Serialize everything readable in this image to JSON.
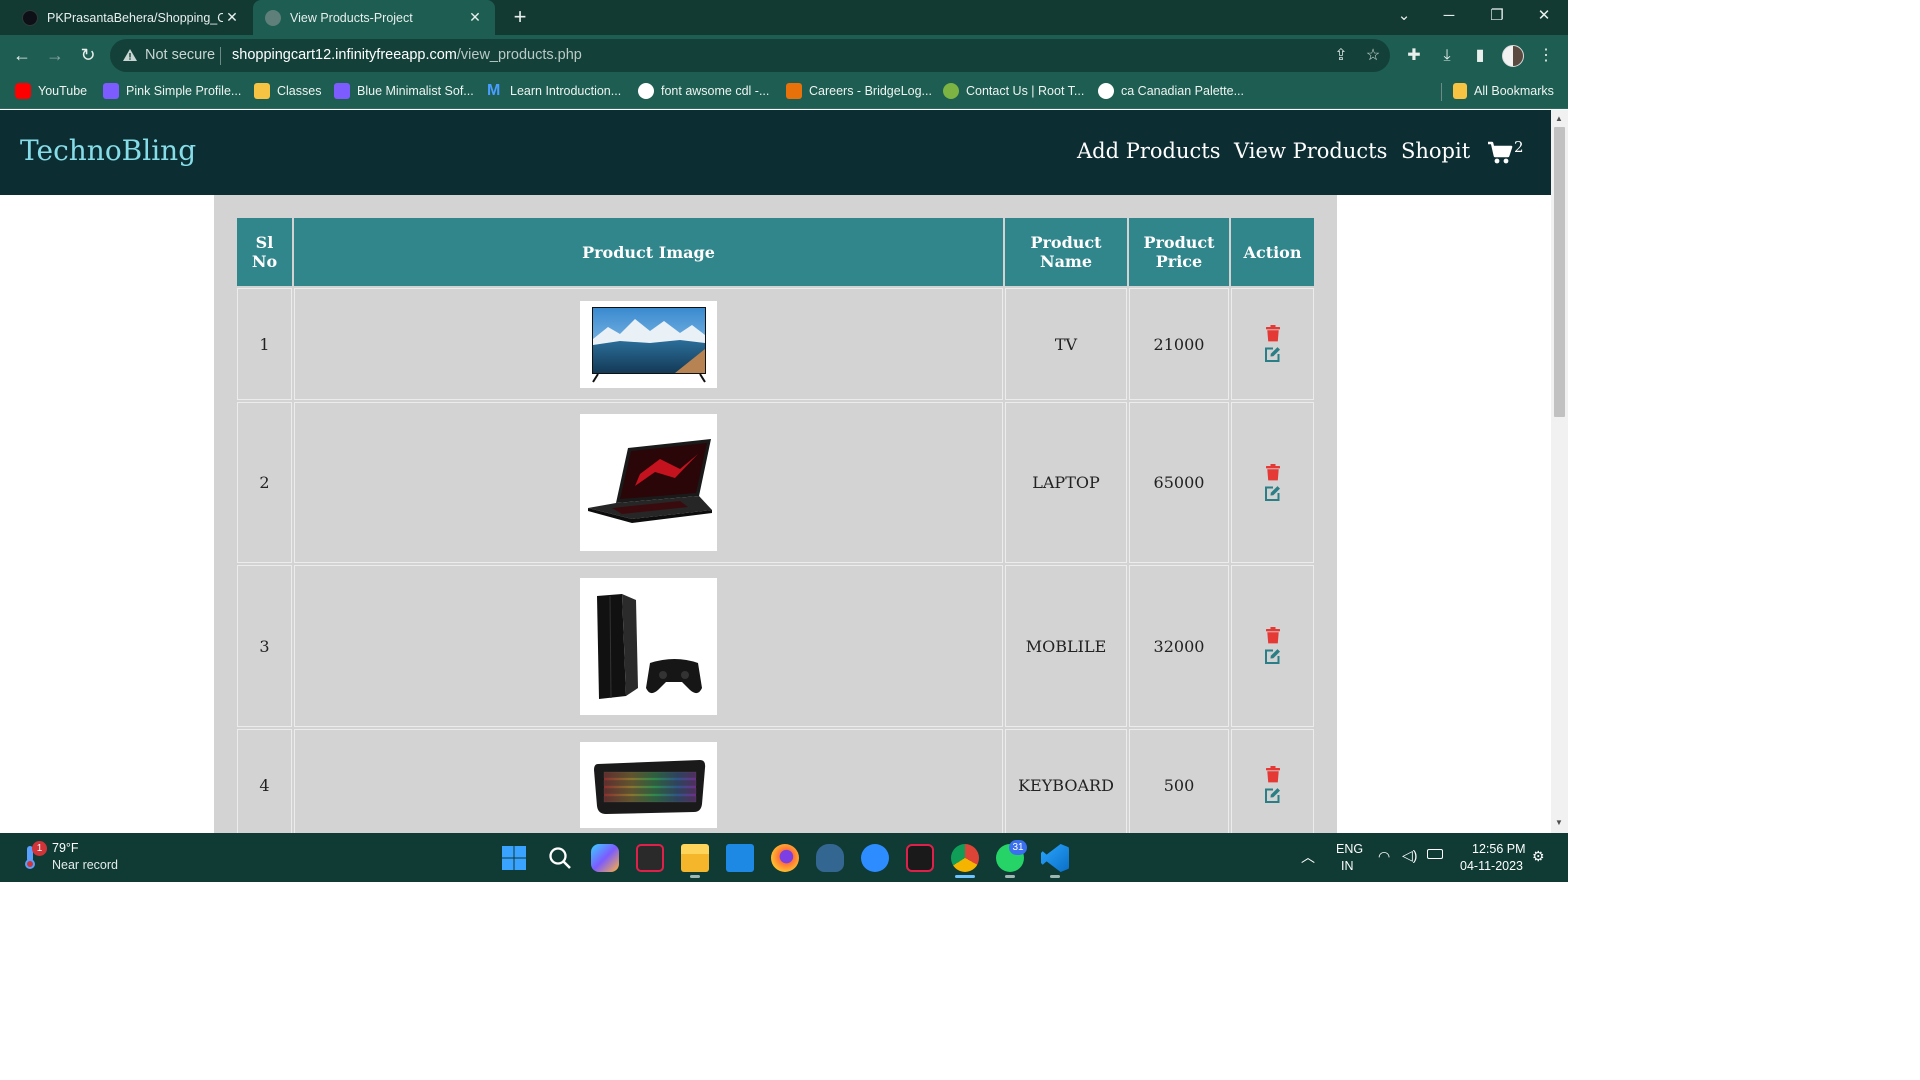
{
  "browser": {
    "tabs": [
      {
        "title": "PKPrasantaBehera/Shopping_Ca"
      },
      {
        "title": "View Products-Project"
      }
    ],
    "omnibox": {
      "security_label": "Not secure",
      "url_host": "shoppingcart12.infinityfreeapp.com",
      "url_path": "/view_products.php"
    },
    "bookmarks": [
      {
        "label": "YouTube",
        "color": "#ff0000"
      },
      {
        "label": "Pink Simple Profile...",
        "color": "#7c5cff"
      },
      {
        "label": "Classes",
        "color": "#f6c343"
      },
      {
        "label": "Blue Minimalist Sof...",
        "color": "#7c5cff"
      },
      {
        "label": "Learn Introduction...",
        "color": "#1a73e8"
      },
      {
        "label": "font awsome cdl -...",
        "color": "#ffffff"
      },
      {
        "label": "Careers - BridgeLog...",
        "color": "#e8710a"
      },
      {
        "label": "Contact Us | Root T...",
        "color": "#7cb342"
      },
      {
        "label": "ca Canadian Palette...",
        "color": "#ffffff"
      }
    ],
    "all_bookmarks_label": "All Bookmarks"
  },
  "site": {
    "brand": "TechnoBling",
    "nav": {
      "add_products": "Add Products",
      "view_products": "View Products",
      "shopit": "Shopit",
      "cart_count": "2"
    },
    "colors": {
      "navbar": "#0c2e33",
      "brand": "#86dde8",
      "table_header": "#31868c",
      "delete_icon": "#e53935",
      "edit_icon": "#2a7f86"
    }
  },
  "table": {
    "headers": {
      "sl_no": "Sl No",
      "image": "Product Image",
      "name": "Product Name",
      "price": "Product Price",
      "action": "Action"
    },
    "rows": [
      {
        "sl": "1",
        "image": "tv-image",
        "name": "TV",
        "price": "21000"
      },
      {
        "sl": "2",
        "image": "laptop-image",
        "name": "LAPTOP",
        "price": "65000"
      },
      {
        "sl": "3",
        "image": "console-image",
        "name": "MOBLILE",
        "price": "32000"
      },
      {
        "sl": "4",
        "image": "keyboard-image",
        "name": "KEYBOARD",
        "price": "500"
      }
    ]
  },
  "taskbar": {
    "weather_badge": "1",
    "weather_temp": "79°F",
    "weather_desc": "Near record",
    "whatsapp_badge": "31",
    "lang_top": "ENG",
    "lang_bottom": "IN",
    "time": "12:56 PM",
    "date": "04-11-2023"
  }
}
